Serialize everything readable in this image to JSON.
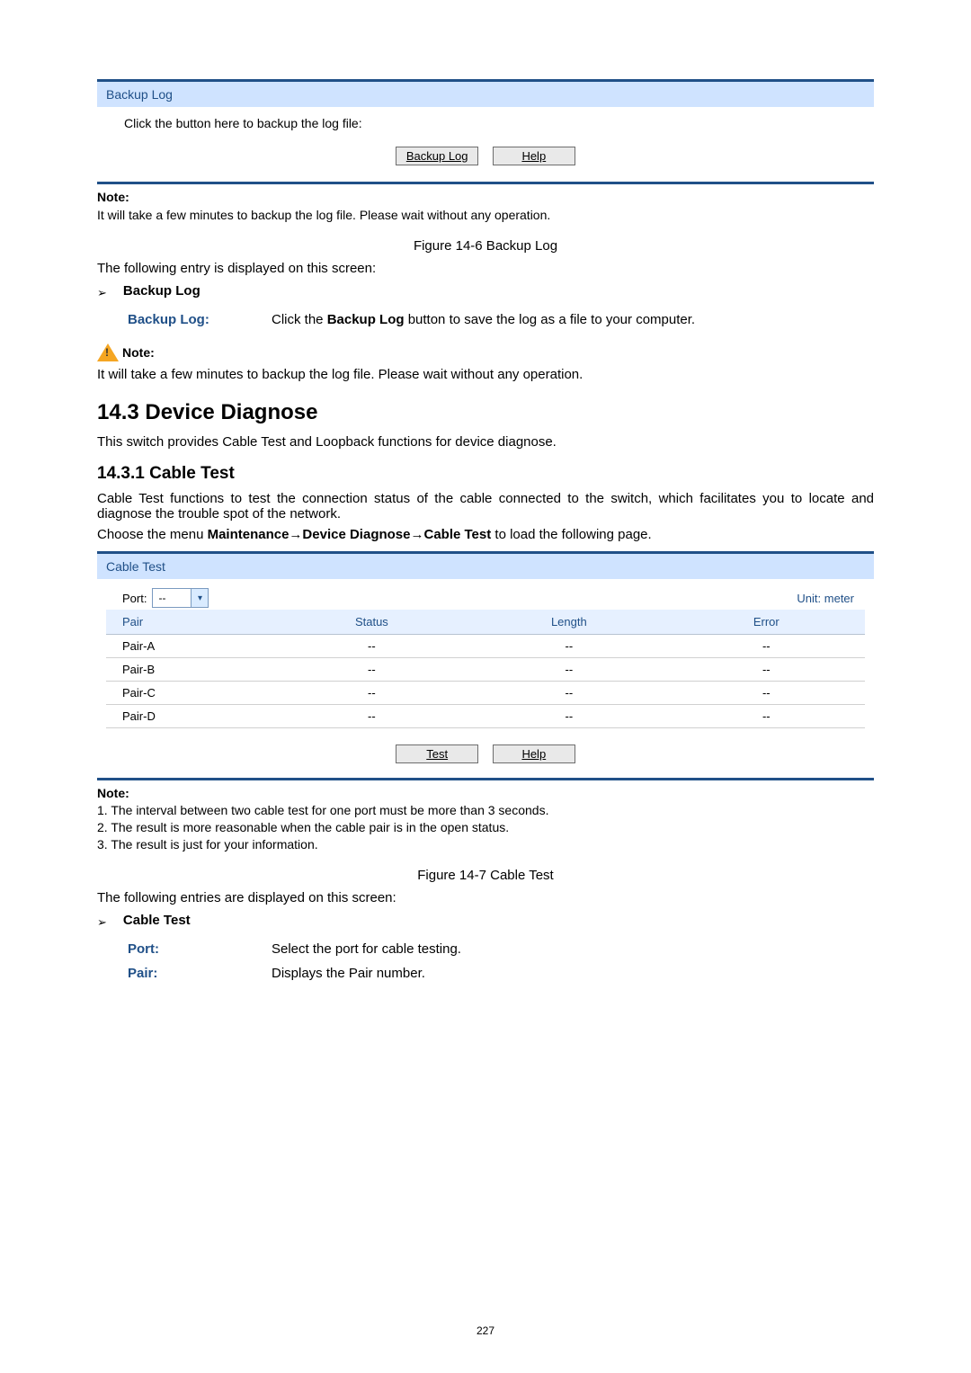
{
  "backup_panel": {
    "title": "Backup Log",
    "instruction": "Click the button here to backup the log file:",
    "btn_backup": "Backup Log",
    "btn_help": "Help"
  },
  "backup_note": {
    "label": "Note:",
    "text": "It will take a few minutes to backup the log file. Please wait without any operation."
  },
  "fig1": "Figure 14-6 Backup Log",
  "following1": "The following entry is displayed on this screen:",
  "arrow1": "Backup Log",
  "def_backup": {
    "label": "Backup Log:",
    "text_pre": "Click the ",
    "text_bold": "Backup Log",
    "text_post": " button to save the log as a file to your computer."
  },
  "warn_note": {
    "label": "Note:",
    "text": "It will take a few minutes to backup the log file. Please wait without any operation."
  },
  "h2": "14.3 Device Diagnose",
  "h2_desc": "This switch provides Cable Test and Loopback functions for device diagnose.",
  "h3": "14.3.1  Cable Test",
  "h3_desc": "Cable Test functions to test the connection status of the cable connected to the switch, which facilitates you to locate and diagnose the trouble spot of the network.",
  "menu_path": {
    "pre": "Choose the menu ",
    "bold": "Maintenance→Device Diagnose→Cable Test",
    "post": " to load the following page."
  },
  "cable_panel": {
    "title": "Cable Test",
    "port_label": "Port:",
    "port_value": "--",
    "unit": "Unit: meter",
    "cols": [
      "Pair",
      "Status",
      "Length",
      "Error"
    ],
    "rows": [
      {
        "pair": "Pair-A",
        "status": "--",
        "length": "--",
        "error": "--"
      },
      {
        "pair": "Pair-B",
        "status": "--",
        "length": "--",
        "error": "--"
      },
      {
        "pair": "Pair-C",
        "status": "--",
        "length": "--",
        "error": "--"
      },
      {
        "pair": "Pair-D",
        "status": "--",
        "length": "--",
        "error": "--"
      }
    ],
    "btn_test": "Test",
    "btn_help": "Help"
  },
  "cable_note": {
    "label": "Note:",
    "n1": "1. The interval between two cable test for one port must be more than 3 seconds.",
    "n2": "2. The result is more reasonable when the cable pair is in the open status.",
    "n3": "3. The result is just for your information."
  },
  "fig2": "Figure 14-7 Cable Test",
  "following2": "The following entries are displayed on this screen:",
  "arrow2": "Cable Test",
  "def_port": {
    "label": "Port:",
    "text": "Select the port for cable testing."
  },
  "def_pair": {
    "label": "Pair:",
    "text": "Displays the Pair number."
  },
  "page_num": "227"
}
